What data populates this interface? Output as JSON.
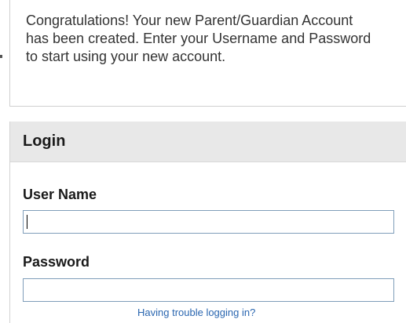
{
  "message": {
    "text": "Congratulations! Your new Parent/Guardian Account has been created. Enter your Username and Password to start using your new account."
  },
  "login": {
    "title": "Login",
    "username_label": "User Name",
    "username_value": "",
    "password_label": "Password",
    "password_value": "",
    "trouble_link": "Having trouble logging in?"
  },
  "colors": {
    "header_bg": "#e8e8e8",
    "link": "#2a66b0",
    "input_border": "#7f9db9"
  }
}
